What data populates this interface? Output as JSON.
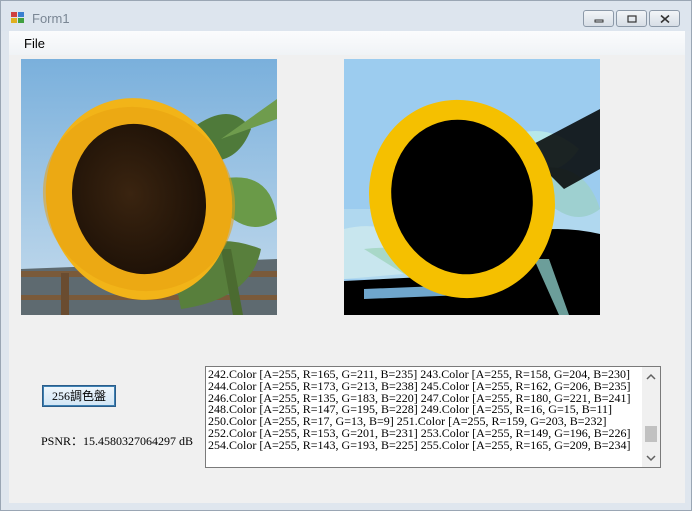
{
  "window": {
    "title": "Form1"
  },
  "menu": {
    "file": "File"
  },
  "button": {
    "label": "256調色盤"
  },
  "psnr": "PSNR：15.4580327064297 dB",
  "output_lines": [
    "242.Color [A=255, R=165, G=211, B=235] 243.Color [A=255, R=158, G=204, B=230]",
    "244.Color [A=255, R=173, G=213, B=238] 245.Color [A=255, R=162, G=206, B=235]",
    "246.Color [A=255, R=135, G=183, B=220] 247.Color [A=255, R=180, G=221, B=241]",
    "248.Color [A=255, R=147, G=195, B=228] 249.Color [A=255, R=16, G=15, B=11]",
    "250.Color [A=255, R=17, G=13, B=9] 251.Color [A=255, R=159, G=203, B=232]",
    "252.Color [A=255, R=153, G=201, B=231] 253.Color [A=255, R=149, G=196, B=226]",
    "254.Color [A=255, R=143, G=193, B=225] 255.Color [A=255, R=165, G=209, B=234]"
  ],
  "scrollbar": {
    "position": 0.85
  },
  "colors": {
    "petal": "#f2b418",
    "sky": "#9cc8e6",
    "center": "#2a180c"
  }
}
